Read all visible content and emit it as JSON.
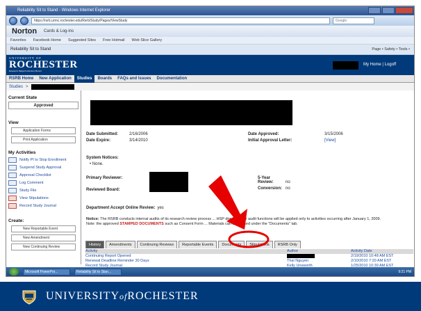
{
  "ie": {
    "title": "Reliability Sit to Stand - Windows Internet Explorer",
    "url": "https://rsrb.urmc.rochester.edu/Rsrb/Study/Pages/ViewStudy",
    "search_placeholder": "Google",
    "norton_brand": "Norton",
    "norton_item": "Cards & Log-ins",
    "favorites": [
      "Favorites",
      "Facebook Home",
      "Suggested Sites",
      "Free Hotmail",
      "Web Slice Gallery"
    ],
    "tab_title": "Reliability Sit to Stand",
    "tools": "Page • Safety • Tools •"
  },
  "header": {
    "small_top": "UNIVERSITY OF",
    "wordmark": "ROCHESTER",
    "subtitle": "Research Subjects Review Board",
    "links": "My Home | Logoff"
  },
  "menu": {
    "items": [
      "RSRB Home",
      "New Application",
      "Studies",
      "Boards",
      "FAQs and Issues",
      "Documentation"
    ],
    "active_index": 2
  },
  "breadcrumb": {
    "root": "Studies",
    "sep": ">"
  },
  "sidebar": {
    "current_state_h": "Current State",
    "current_state_value": "Approved",
    "view_h": "View",
    "view_buttons": [
      "Application Forms",
      "Print Application"
    ],
    "activities_h": "My Activities",
    "activities": [
      {
        "label": "Notify PI to Stop Enrollment",
        "icon": "notify-icon",
        "red": false
      },
      {
        "label": "Suspend Study Approval",
        "icon": "suspend-icon",
        "red": false
      },
      {
        "label": "Approval Checklist",
        "icon": "checklist-icon",
        "red": false
      },
      {
        "label": "Log Comment",
        "icon": "comment-icon",
        "red": false
      },
      {
        "label": "Study File",
        "icon": "file-icon",
        "red": false
      },
      {
        "label": "View Stipulations",
        "icon": "stipulations-icon",
        "red": true
      },
      {
        "label": "Record Study Journal",
        "icon": "journal-icon",
        "red": true
      }
    ],
    "create_h": "Create:",
    "create_buttons": [
      "New Reportable Event",
      "New Amendment",
      "New Continuing Review"
    ]
  },
  "study": {
    "date_submitted_label": "Date Submitted:",
    "date_submitted": "2/16/2006",
    "date_expire_label": "Date Expire:",
    "date_expire": "3/14/2010",
    "date_approved_label": "Date Approved:",
    "date_approved": "3/15/2006",
    "initial_letter_label": "Initial Approval Letter:",
    "initial_letter_link": "[View]",
    "system_notices_label": "System Notices:",
    "system_notices_value": "• None.",
    "primary_reviewer_label": "Primary Reviewer:",
    "five_year_label": "5-Year Review:",
    "five_year_value": "no",
    "reviewed_board_label": "Reviewed Board:",
    "conversion_label": "Conversion:",
    "conversion_value": "no",
    "accept_online_label": "Department Accept Online Review:",
    "accept_online_value": "yes",
    "notice_label": "Notice:",
    "notice_text": "The RSRB conducts internal audits of its research review process ... HSP directive, the audit functions will be applied only to activities occurring after January 1, 2009.",
    "note_prefix": "Note: the approved",
    "note_stamped": "STAMPED DOCUMENTS",
    "note_suffix": "such as Consent Form ... Materials can be located under the \"Documents\" tab."
  },
  "tabs": [
    "History",
    "Amendments",
    "Continuing Reviews",
    "Reportable Events",
    "Documents",
    "Stipulations",
    "RSRB Only"
  ],
  "history_table": {
    "headers": [
      "Activity",
      "Author",
      "Activity Date"
    ],
    "rows": [
      [
        "Continuing Report Opened",
        "",
        "2/19/2010 10:48 AM EST"
      ],
      [
        "Renewal Deadline Reminder 30 Days",
        "Thai Nguyen",
        "2/10/2010 7:20 AM EST"
      ],
      [
        "Record Study Journal",
        "Kelly Unsworth",
        "1/25/2010 10:39 AM EST"
      ]
    ]
  },
  "taskbar": {
    "tasks": [
      "Microsoft PowerPoi...",
      "Reliability Sit to Stan..."
    ],
    "clock": "9:21 PM"
  },
  "footer": {
    "university": "UNIVERSITY",
    "of": "of",
    "rochester": "ROCHESTER"
  },
  "colors": {
    "brand_blue": "#003a7a",
    "callout_red": "#e60000",
    "stamped_red": "#c41a1a"
  }
}
